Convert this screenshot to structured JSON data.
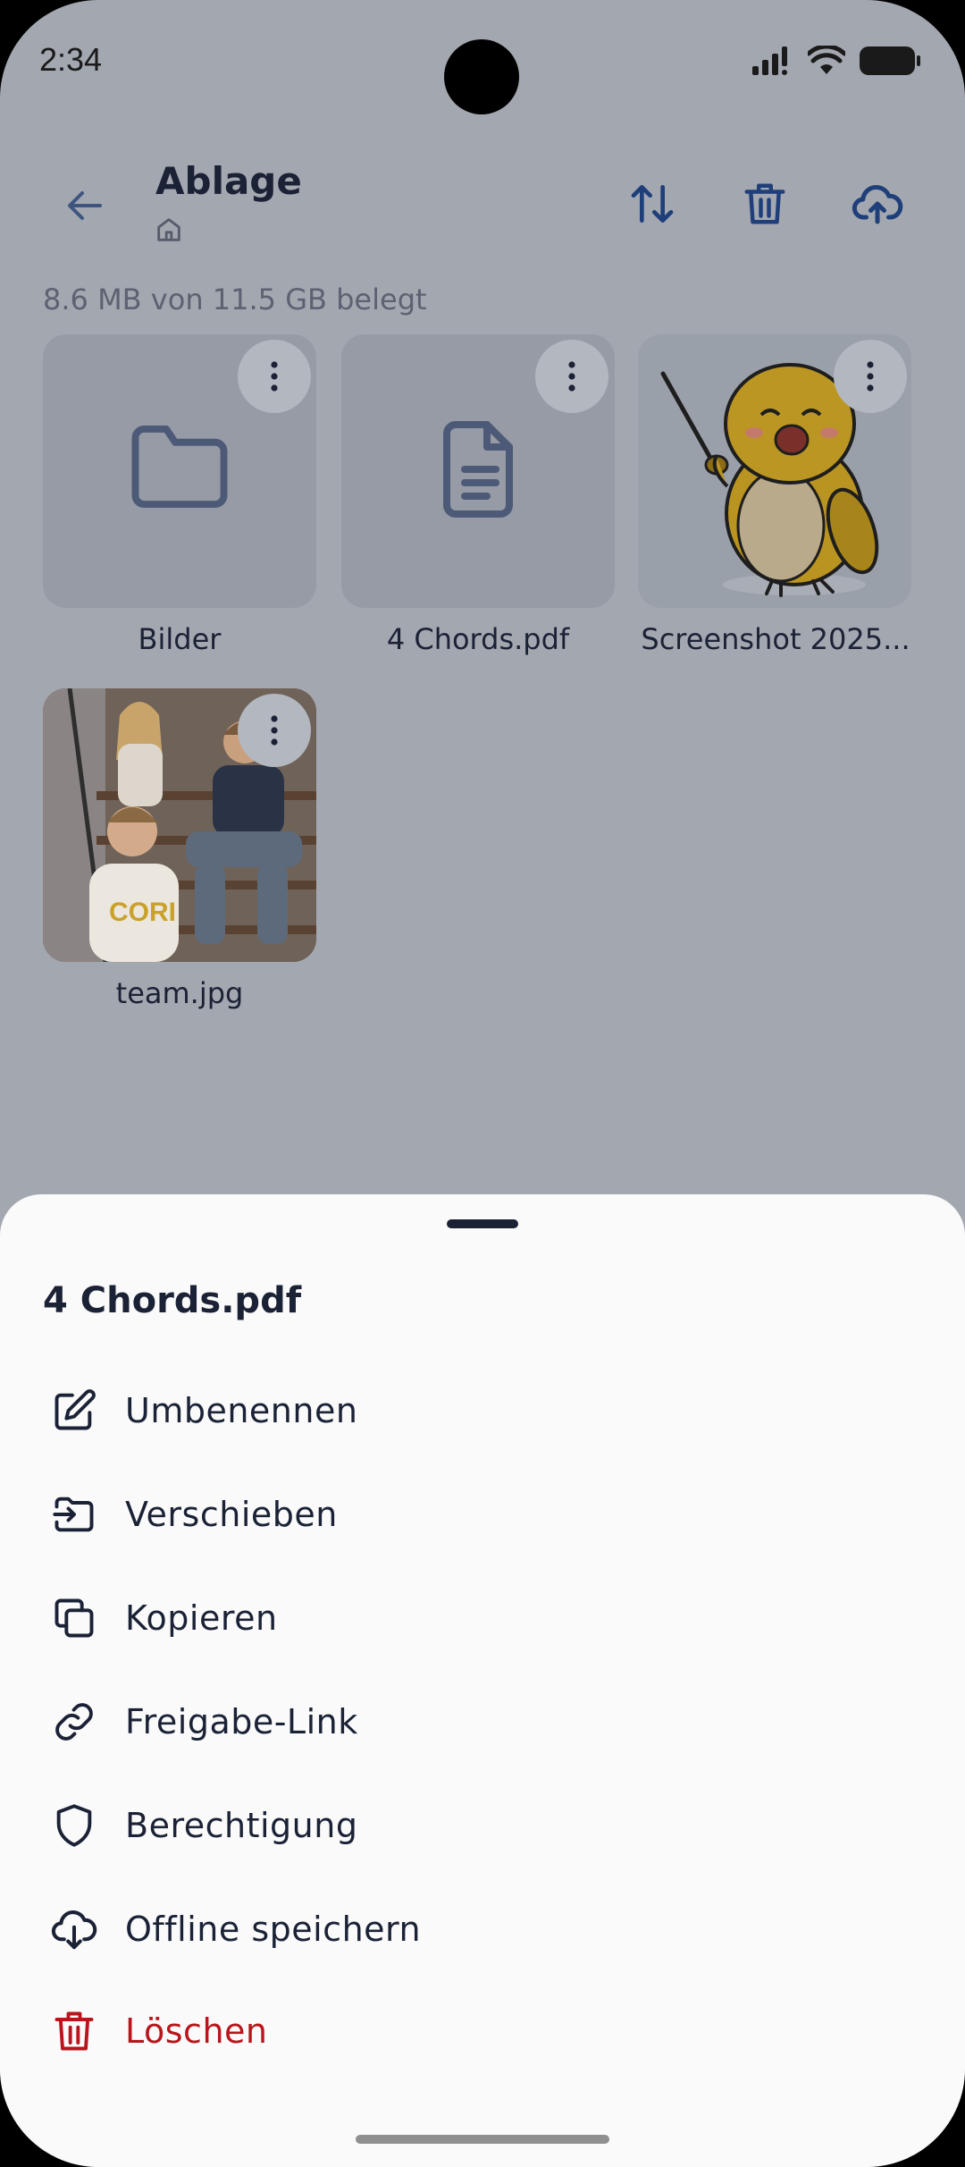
{
  "status_bar": {
    "time": "2:34"
  },
  "header": {
    "title": "Ablage",
    "storage_text": "8.6 MB von 11.5 GB belegt"
  },
  "files": [
    {
      "name": "Bilder",
      "type": "folder"
    },
    {
      "name": "4 Chords.pdf",
      "type": "document"
    },
    {
      "name": "Screenshot 2025...",
      "type": "image"
    },
    {
      "name": "team.jpg",
      "type": "image"
    }
  ],
  "sheet": {
    "title": "4 Chords.pdf",
    "items": [
      {
        "label": "Umbenennen",
        "icon": "edit-icon"
      },
      {
        "label": "Verschieben",
        "icon": "move-icon"
      },
      {
        "label": "Kopieren",
        "icon": "copy-icon"
      },
      {
        "label": "Freigabe-Link",
        "icon": "link-icon"
      },
      {
        "label": "Berechtigung",
        "icon": "shield-icon"
      },
      {
        "label": "Offline speichern",
        "icon": "cloud-download-icon"
      },
      {
        "label": "Löschen",
        "icon": "trash-icon"
      }
    ]
  },
  "colors": {
    "overlay_bg": "#a3a7b0",
    "accent": "#1f3f7a",
    "danger": "#b8161c",
    "sheet_bg": "#fafafa"
  }
}
